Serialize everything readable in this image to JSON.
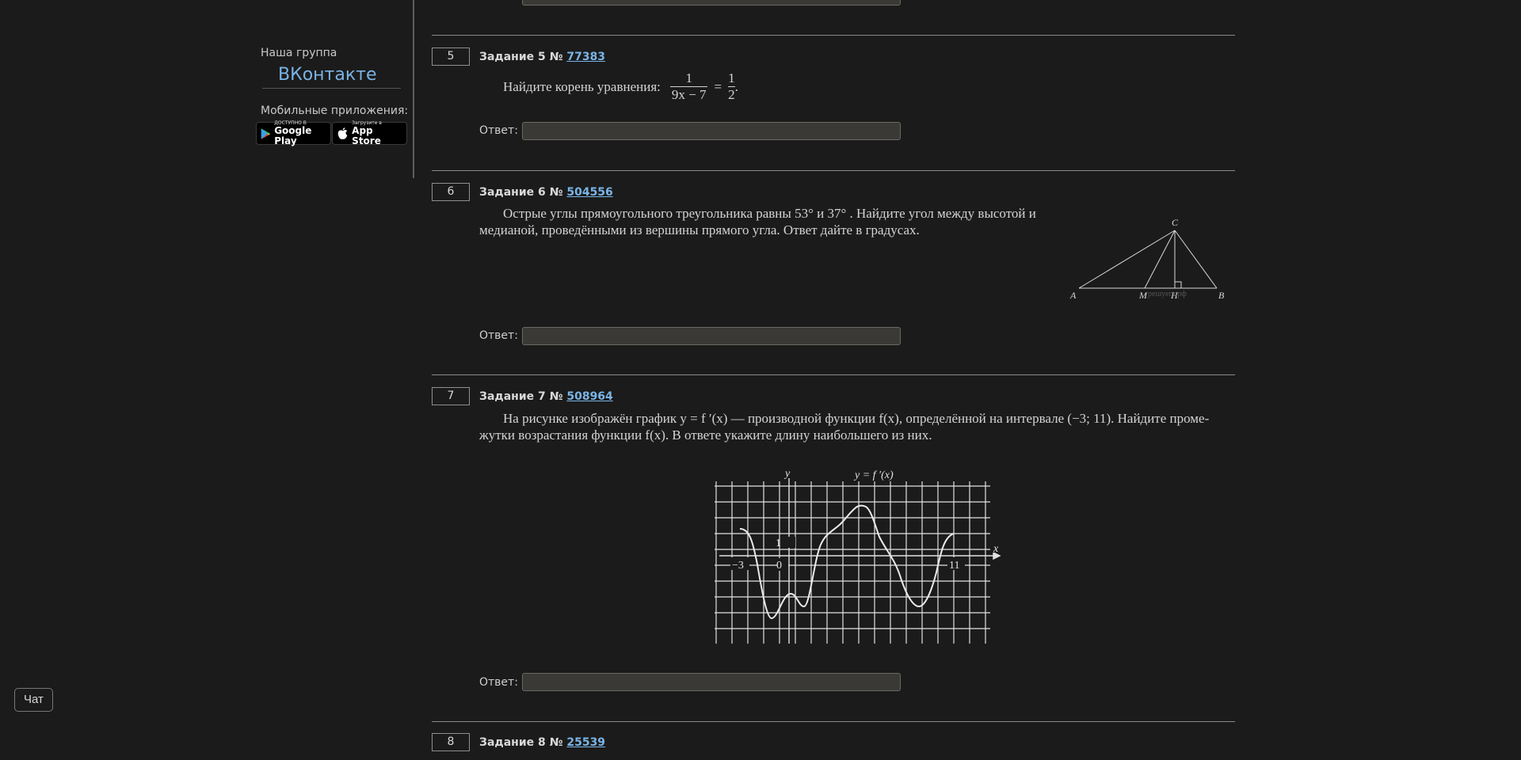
{
  "sidebar": {
    "group_label": "Наша группа",
    "vk_link": "ВКонтакте",
    "apps_label": "Мобильные приложения:",
    "google_play": {
      "small": "ДОСТУПНО В",
      "big": "Google Play"
    },
    "app_store": {
      "small": "Загрузите в",
      "big": "App Store"
    }
  },
  "chat_button": "Чат",
  "answer_label": "Ответ:",
  "tasks": [
    {
      "number": "5",
      "title": "Задание 5 №",
      "id": "77383",
      "text": "Найдите корень уравнения:",
      "eq": {
        "num1": "1",
        "den1": "9x − 7",
        "eq": "=",
        "num2": "1",
        "den2": "2",
        "end": "."
      }
    },
    {
      "number": "6",
      "title": "Задание 6 №",
      "id": "504556",
      "text": "Острые углы прямоугольного треугольника равны 53° и 37° . Найдите угол между высотой и медианой, проведёнными из вершины прямого угла. Ответ дайте в градусах.",
      "figure_labels": {
        "A": "A",
        "B": "B",
        "C": "C",
        "M": "M",
        "H": "H",
        "watermark": "решуегэ.рф"
      }
    },
    {
      "number": "7",
      "title": "Задание 7 №",
      "id": "508964",
      "text_line1": "На рисунке изображён график y = f ′(x) — производной функции f(x), определённой на интервале (−3; 11). Найдите проме-",
      "text_line2": "жутки возрастания функции f(x). В ответе укажите длину наибольшего из них.",
      "graph_labels": {
        "y": "y",
        "x": "x",
        "func": "y = f ′(x)",
        "one": "1",
        "zero": "0",
        "minus3": "−3",
        "eleven": "11"
      }
    },
    {
      "number": "8",
      "title": "Задание 8 №",
      "id": "25539"
    }
  ]
}
